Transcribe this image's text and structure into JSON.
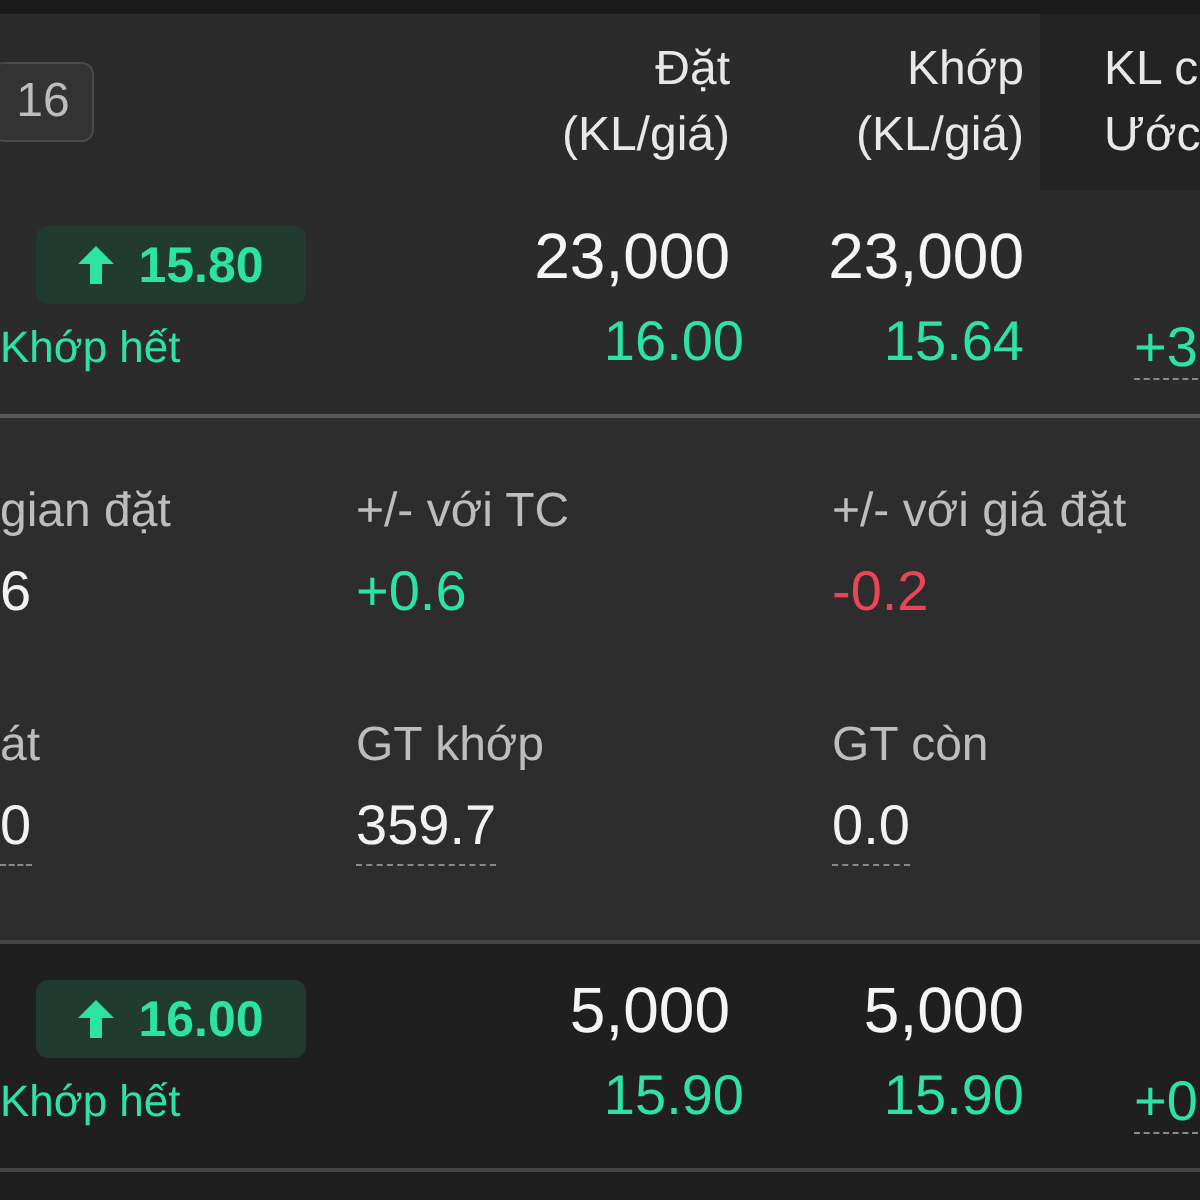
{
  "header": {
    "badge": "16",
    "columns": [
      {
        "lines": [
          "Đặt",
          "(KL/giá)"
        ]
      },
      {
        "lines": [
          "Khớp",
          "(KL/giá)"
        ]
      },
      {
        "lines": [
          "KL c",
          "Ước"
        ]
      }
    ]
  },
  "orders": [
    {
      "expanded": true,
      "price": "15.80",
      "status": "Khớp hết",
      "placed_volume": "23,000",
      "placed_price": "16.00",
      "matched_volume": "23,000",
      "matched_price": "15.64",
      "column_3": "+3",
      "detail": [
        {
          "label": "gian đặt",
          "value": "6",
          "kind": "plain"
        },
        {
          "label": "+/- với TC",
          "value": "+0.6",
          "kind": "gain"
        },
        {
          "label": "+/- với giá đặt",
          "value": "-0.2",
          "kind": "loss"
        },
        {
          "label": "át",
          "value": "0",
          "kind": "dashed"
        },
        {
          "label": "GT khớp",
          "value": "359.7",
          "kind": "dashed"
        },
        {
          "label": "GT còn",
          "value": "0.0",
          "kind": "dashed"
        }
      ]
    },
    {
      "expanded": false,
      "price": "16.00",
      "status": "Khớp hết",
      "placed_volume": "5,000",
      "placed_price": "15.90",
      "matched_volume": "5,000",
      "matched_price": "15.90",
      "column_3": "+0"
    }
  ]
}
